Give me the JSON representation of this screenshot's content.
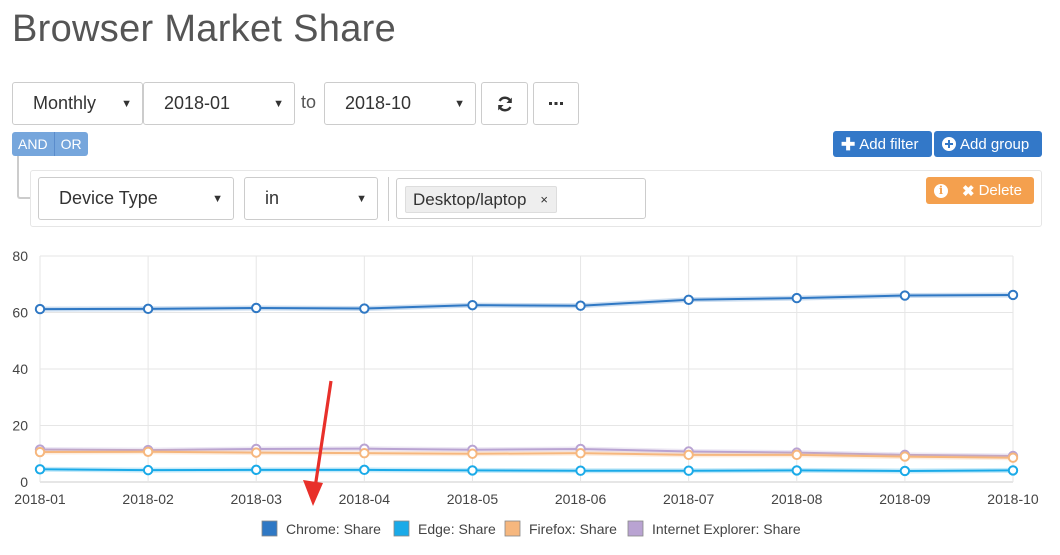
{
  "page_title": "Browser Market Share",
  "controls": {
    "granularity": "Monthly",
    "from": "2018-01",
    "to_label": "to",
    "to": "2018-10"
  },
  "query": {
    "and_label": "AND",
    "or_label": "OR",
    "add_filter_label": "Add filter",
    "add_group_label": "Add group",
    "rule": {
      "field": "Device Type",
      "operator": "in",
      "value_tag": "Desktop/laptop",
      "remove_tag": "×",
      "delete_label": "Delete"
    }
  },
  "chart_data": {
    "type": "line",
    "x": [
      "2018-01",
      "2018-02",
      "2018-03",
      "2018-04",
      "2018-05",
      "2018-06",
      "2018-07",
      "2018-08",
      "2018-09",
      "2018-10"
    ],
    "ylim": [
      0,
      80
    ],
    "yticks": [
      0,
      20,
      40,
      60,
      80
    ],
    "grid": true,
    "legend_position": "bottom",
    "series": [
      {
        "name": "Chrome: Share",
        "color": "#2f78c4",
        "values": [
          61.2,
          61.3,
          61.6,
          61.4,
          62.6,
          62.4,
          64.5,
          65.1,
          66.0,
          66.2
        ]
      },
      {
        "name": "Edge: Share",
        "color": "#1aaae8",
        "values": [
          4.5,
          4.2,
          4.3,
          4.3,
          4.1,
          4.0,
          4.0,
          4.1,
          3.9,
          4.1
        ]
      },
      {
        "name": "Firefox: Share",
        "color": "#f6b77e",
        "values": [
          10.6,
          10.7,
          10.4,
          10.2,
          10.0,
          10.2,
          9.6,
          9.6,
          9.0,
          8.6
        ]
      },
      {
        "name": "Internet Explorer: Share",
        "color": "#b9a3d2",
        "values": [
          11.5,
          11.3,
          11.7,
          11.8,
          11.4,
          11.7,
          10.8,
          10.4,
          9.6,
          9.2
        ]
      }
    ]
  }
}
